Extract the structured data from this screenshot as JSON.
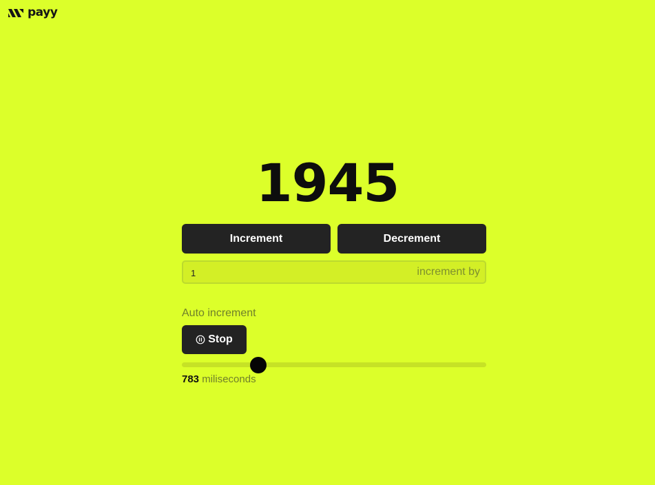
{
  "brand": {
    "name": "payy",
    "logo_icon": "payy-logo-icon"
  },
  "counter": {
    "value": "1945"
  },
  "buttons": {
    "increment_label": "Increment",
    "decrement_label": "Decrement"
  },
  "increment_by": {
    "value": "1",
    "suffix": "increment by"
  },
  "auto_increment": {
    "label": "Auto increment",
    "stop_label": "Stop",
    "stop_icon": "pause-circle-icon",
    "interval_value": "783",
    "interval_unit": "miliseconds",
    "slider_fraction": 0.25
  },
  "colors": {
    "background": "#DCFF2A",
    "button": "#232323",
    "button_text": "#FFFFFF",
    "muted_text": "#6F7F2B"
  }
}
